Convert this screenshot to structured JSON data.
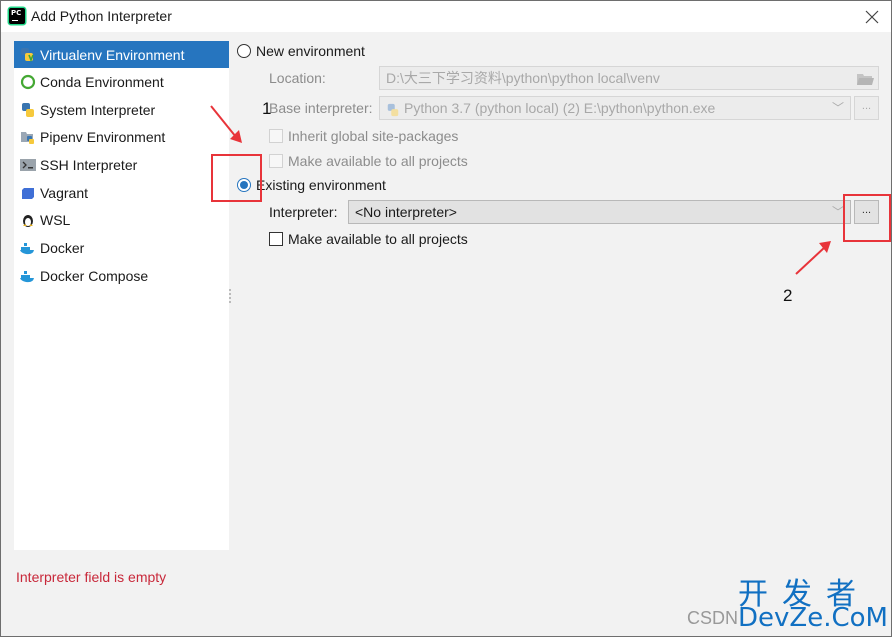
{
  "window": {
    "title": "Add Python Interpreter",
    "close_icon": "close-icon"
  },
  "sidebar": {
    "items": [
      {
        "label": "Virtualenv Environment",
        "icon": "virtualenv-icon",
        "selected": true
      },
      {
        "label": "Conda Environment",
        "icon": "conda-icon",
        "selected": false
      },
      {
        "label": "System Interpreter",
        "icon": "python-icon",
        "selected": false
      },
      {
        "label": "Pipenv Environment",
        "icon": "pipenv-icon",
        "selected": false
      },
      {
        "label": "SSH Interpreter",
        "icon": "terminal-icon",
        "selected": false
      },
      {
        "label": "Vagrant",
        "icon": "vagrant-icon",
        "selected": false
      },
      {
        "label": "WSL",
        "icon": "linux-penguin-icon",
        "selected": false
      },
      {
        "label": "Docker",
        "icon": "docker-icon",
        "selected": false
      },
      {
        "label": "Docker Compose",
        "icon": "docker-compose-icon",
        "selected": false
      }
    ]
  },
  "new_env": {
    "radio_label": "New environment",
    "selected": false,
    "location_label": "Location:",
    "location_value": "D:\\大三下学习资料\\python\\python local\\venv",
    "base_interpreter_label": "Base interpreter:",
    "base_interpreter_value": "Python 3.7 (python local) (2) E:\\python\\python.exe",
    "inherit_label": "Inherit global site-packages",
    "inherit_checked": false,
    "make_available_label": "Make available to all projects",
    "make_available_checked": false,
    "browse_label": "..."
  },
  "existing_env": {
    "radio_label": "Existing environment",
    "selected": true,
    "interpreter_label": "Interpreter:",
    "interpreter_value": "<No interpreter>",
    "browse_label": "...",
    "make_available_label": "Make available to all projects",
    "make_available_checked": false
  },
  "error_message": "Interpreter field is empty",
  "annotations": {
    "step1": "1",
    "step2": "2",
    "color": "#e8343a"
  },
  "watermark": {
    "cn": "开发者",
    "en": "DevZe.CoM",
    "csdn": "CSDN"
  }
}
